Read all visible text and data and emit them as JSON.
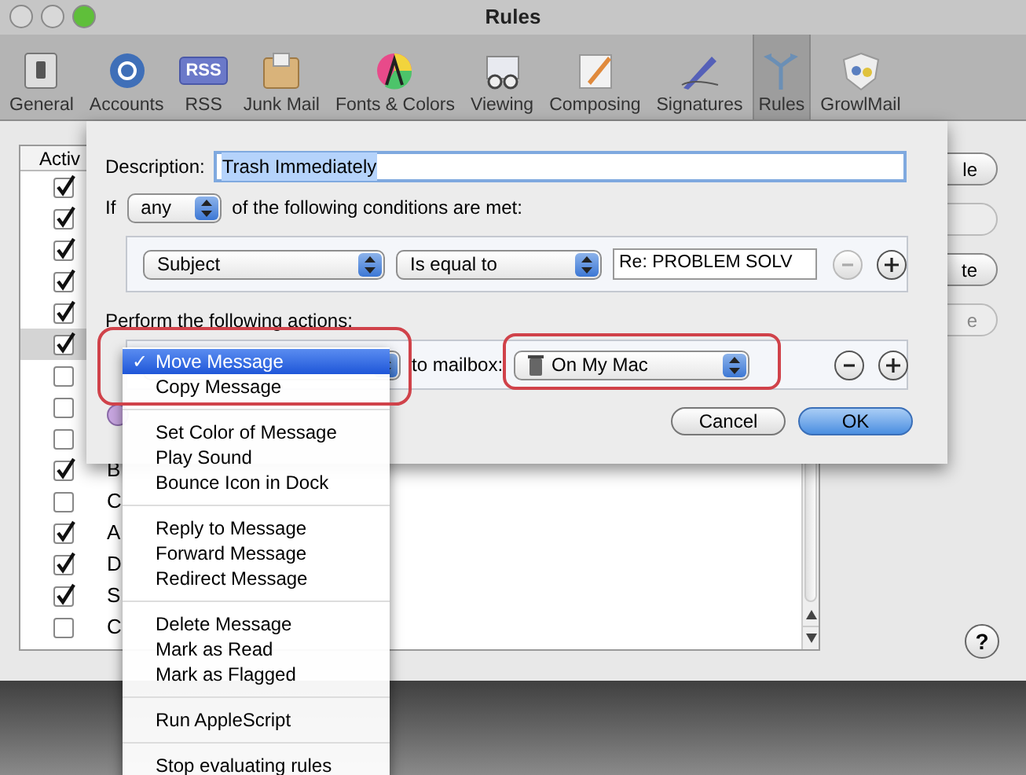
{
  "window": {
    "title": "Rules"
  },
  "toolbar": [
    {
      "label": "General",
      "selected": false
    },
    {
      "label": "Accounts",
      "selected": false
    },
    {
      "label": "RSS",
      "selected": false,
      "icon_text": "RSS"
    },
    {
      "label": "Junk Mail",
      "selected": false
    },
    {
      "label": "Fonts & Colors",
      "selected": false
    },
    {
      "label": "Viewing",
      "selected": false
    },
    {
      "label": "Composing",
      "selected": false
    },
    {
      "label": "Signatures",
      "selected": false
    },
    {
      "label": "Rules",
      "selected": true
    },
    {
      "label": "GrowlMail",
      "selected": false
    }
  ],
  "rules_list": {
    "header": "Activ",
    "rows": [
      {
        "active": true,
        "selected": false
      },
      {
        "active": true,
        "selected": false
      },
      {
        "active": true,
        "selected": false
      },
      {
        "active": true,
        "selected": false
      },
      {
        "active": true,
        "selected": false
      },
      {
        "active": true,
        "selected": true
      },
      {
        "active": false,
        "selected": false
      },
      {
        "active": false,
        "selected": false
      },
      {
        "active": false,
        "selected": false
      },
      {
        "active": true,
        "selected": false,
        "name": "B"
      },
      {
        "active": false,
        "selected": false,
        "name": "C"
      },
      {
        "active": true,
        "selected": false,
        "name": "A"
      },
      {
        "active": true,
        "selected": false,
        "name": "D"
      },
      {
        "active": true,
        "selected": false,
        "name": "S"
      },
      {
        "active": false,
        "selected": false,
        "name": "C"
      }
    ]
  },
  "side_buttons": [
    {
      "text": "le",
      "disabled": false
    },
    {
      "disabled": true
    },
    {
      "text": "te",
      "disabled": false
    },
    {
      "text": "e",
      "disabled": true
    }
  ],
  "help_button": "?",
  "sheet": {
    "description_label": "Description:",
    "description_value": "Trash Immediately",
    "if_label": "If",
    "match_popup": "any",
    "conditions_suffix": "of the following conditions are met:",
    "conditions": [
      {
        "field": "Subject",
        "operator": "Is equal to",
        "value": "Re: PROBLEM SOLV",
        "remove_disabled": true
      }
    ],
    "actions_label": "Perform the following actions:",
    "actions": [
      {
        "target_label": "to mailbox:",
        "mailbox": "On My Mac",
        "remove_disabled": false
      }
    ],
    "buttons": [
      {
        "label": "Cancel",
        "default": false
      },
      {
        "label": "OK",
        "default": true
      }
    ]
  },
  "action_menu": {
    "check_mark": "✓",
    "groups": [
      [
        {
          "label": "Move Message",
          "selected": true
        },
        {
          "label": "Copy Message",
          "selected": false
        }
      ],
      [
        {
          "label": "Set Color of Message",
          "selected": false
        },
        {
          "label": "Play Sound",
          "selected": false
        },
        {
          "label": "Bounce Icon in Dock",
          "selected": false
        }
      ],
      [
        {
          "label": "Reply to Message",
          "selected": false
        },
        {
          "label": "Forward Message",
          "selected": false
        },
        {
          "label": "Redirect Message",
          "selected": false
        }
      ],
      [
        {
          "label": "Delete Message",
          "selected": false
        },
        {
          "label": "Mark as Read",
          "selected": false
        },
        {
          "label": "Mark as Flagged",
          "selected": false
        }
      ],
      [
        {
          "label": "Run AppleScript",
          "selected": false
        }
      ],
      [
        {
          "label": "Stop evaluating rules",
          "selected": false
        }
      ]
    ]
  }
}
